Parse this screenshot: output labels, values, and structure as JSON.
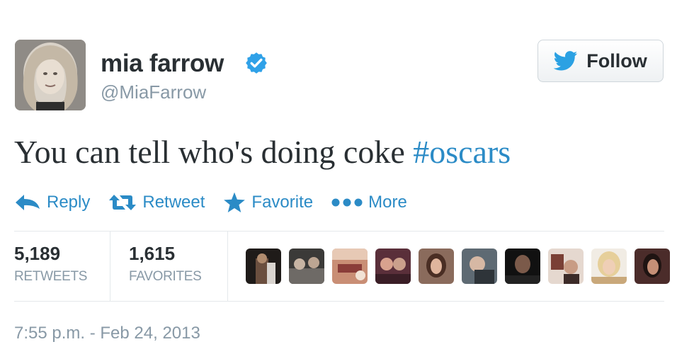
{
  "user": {
    "display_name": "mia farrow",
    "handle": "@MiaFarrow",
    "verified": true,
    "avatar_icon": "profile-photo"
  },
  "follow_button": {
    "label": "Follow",
    "icon": "twitter-bird-icon"
  },
  "tweet": {
    "text": "You can tell who's doing coke ",
    "hashtag": "#oscars"
  },
  "actions": {
    "reply_label": "Reply",
    "retweet_label": "Retweet",
    "favorite_label": "Favorite",
    "more_label": "More"
  },
  "stats": {
    "retweets_count": "5,189",
    "retweets_label": "RETWEETS",
    "favorites_count": "1,615",
    "favorites_label": "FAVORITES"
  },
  "favoriters": [
    {
      "name": "favoriter-1"
    },
    {
      "name": "favoriter-2"
    },
    {
      "name": "favoriter-3"
    },
    {
      "name": "favoriter-4"
    },
    {
      "name": "favoriter-5"
    },
    {
      "name": "favoriter-6"
    },
    {
      "name": "favoriter-7"
    },
    {
      "name": "favoriter-8"
    },
    {
      "name": "favoriter-9"
    }
  ],
  "timestamp": "7:55 p.m. - Feb 24, 2013",
  "colors": {
    "link": "#2b8bc6",
    "verified_badge": "#2fa1e8",
    "muted": "#8899a6",
    "text": "#292f33",
    "twitter_blue": "#2ba1e3"
  }
}
